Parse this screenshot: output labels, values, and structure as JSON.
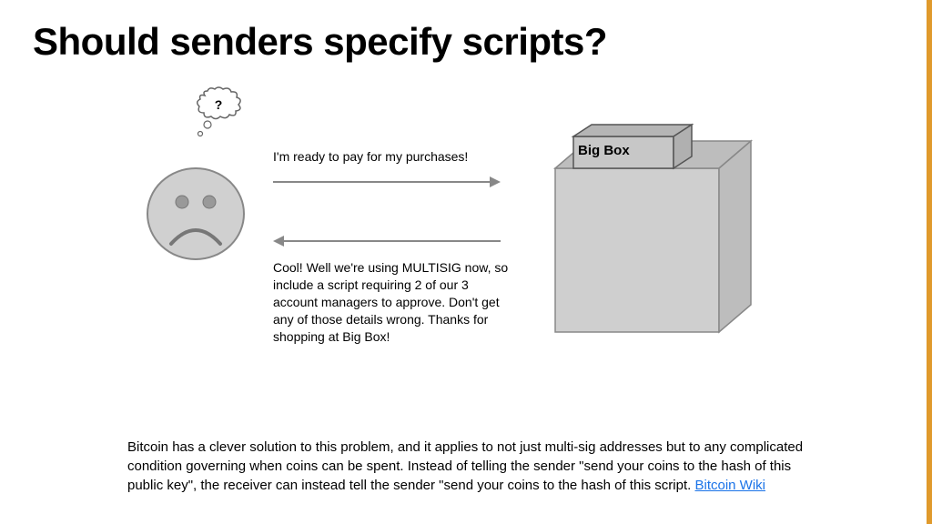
{
  "title": "Should senders specify scripts?",
  "thought_mark": "?",
  "message_top": "I'm ready to pay for my purchases!",
  "message_bottom": "Cool! Well we're using MULTISIG now, so include a script requiring 2 of our 3 account managers to approve. Don't get any of those details wrong. Thanks for shopping at Big Box!",
  "box_label": "Big Box",
  "paragraph": "Bitcoin has a clever solution to this problem, and it applies to not just multi-sig addresses but to any complicated condition governing when coins can be spent. Instead of telling the sender \"send your coins to the hash of this public key\", the receiver can instead tell the sender \"send your coins to the hash of this script. ",
  "link_text": "Bitcoin Wiki"
}
